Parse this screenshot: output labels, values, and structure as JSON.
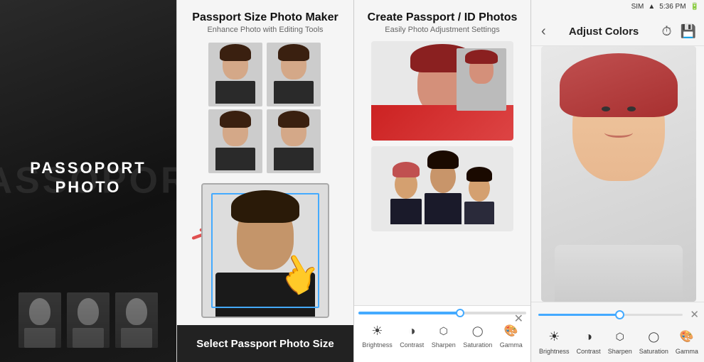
{
  "panel1": {
    "bg_text": "PASSOPORT",
    "title_line1": "PASSOPORT",
    "title_line2": "PHOTO"
  },
  "panel2": {
    "title": "Passport Size Photo Maker",
    "subtitle": "Enhance Photo with Editing Tools",
    "footer_label": "Select Passport Photo Size"
  },
  "panel3": {
    "title": "Create Passport / ID Photos",
    "subtitle": "Easily Photo Adjustment Settings",
    "toolbar": {
      "close_label": "✕",
      "icons": [
        {
          "label": "Brightness",
          "glyph": "☀"
        },
        {
          "label": "Contrast",
          "glyph": "◑"
        },
        {
          "label": "Sharpen",
          "glyph": "◈"
        },
        {
          "label": "Saturation",
          "glyph": "○"
        },
        {
          "label": "Gamma",
          "glyph": "●"
        }
      ]
    }
  },
  "panel4": {
    "back_label": "‹",
    "title": "Adjust Colors",
    "status_bar": {
      "carrier": "SIM",
      "wifi": "WiFi",
      "time": "5:36 PM",
      "battery": "🔋"
    },
    "toolbar": {
      "close_label": "✕",
      "icons": [
        {
          "label": "Brightness",
          "glyph": "☀"
        },
        {
          "label": "Contrast",
          "glyph": "◑"
        },
        {
          "label": "Sharpen",
          "glyph": "◈"
        },
        {
          "label": "Saturation",
          "glyph": "○"
        },
        {
          "label": "Gamma",
          "glyph": "●"
        }
      ]
    }
  }
}
